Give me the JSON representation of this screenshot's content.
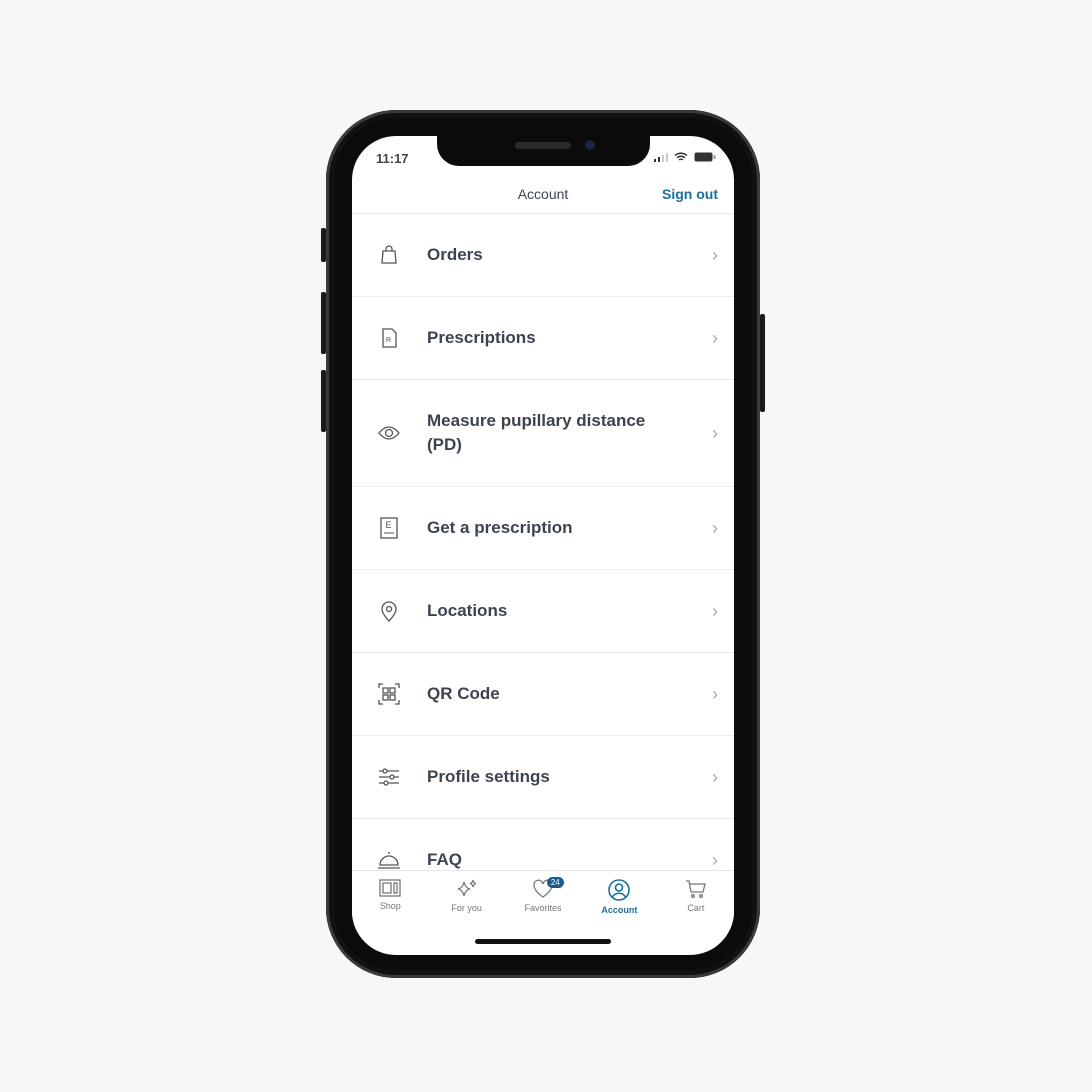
{
  "status_bar": {
    "time": "11:17"
  },
  "header": {
    "title": "Account",
    "sign_out": "Sign out"
  },
  "menu": [
    {
      "label": "Orders",
      "icon": "shopping-bag-icon"
    },
    {
      "label": "Prescriptions",
      "icon": "prescription-document-icon"
    },
    {
      "label": "Measure pupillary distance (PD)",
      "icon": "eye-icon"
    },
    {
      "label": "Get a prescription",
      "icon": "eye-chart-icon"
    },
    {
      "label": "Locations",
      "icon": "location-pin-icon"
    },
    {
      "label": "QR Code",
      "icon": "qr-code-icon"
    },
    {
      "label": "Profile settings",
      "icon": "sliders-icon"
    },
    {
      "label": "FAQ",
      "icon": "service-bell-icon"
    }
  ],
  "tabs": [
    {
      "label": "Shop",
      "icon": "shop-icon"
    },
    {
      "label": "For you",
      "icon": "sparkles-icon"
    },
    {
      "label": "Favorites",
      "icon": "heart-icon",
      "badge": "24"
    },
    {
      "label": "Account",
      "icon": "user-circle-icon",
      "active": true
    },
    {
      "label": "Cart",
      "icon": "cart-icon"
    }
  ],
  "colors": {
    "accent": "#1a6fa0",
    "text": "#3d4450"
  }
}
